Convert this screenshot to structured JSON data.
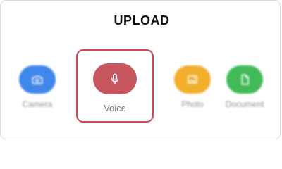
{
  "header": {
    "title": "UPLOAD"
  },
  "options": [
    {
      "id": "camera",
      "label": "Camera",
      "icon": "camera-icon",
      "color": "#2f7dea"
    },
    {
      "id": "voice",
      "label": "Voice",
      "icon": "microphone-icon",
      "color": "#c7575f",
      "selected": true
    },
    {
      "id": "photo",
      "label": "Photo",
      "icon": "image-icon",
      "color": "#f0a91a"
    },
    {
      "id": "document",
      "label": "Document",
      "icon": "document-icon",
      "color": "#32b54a"
    }
  ],
  "colors": {
    "selection_border": "#c74b55"
  }
}
